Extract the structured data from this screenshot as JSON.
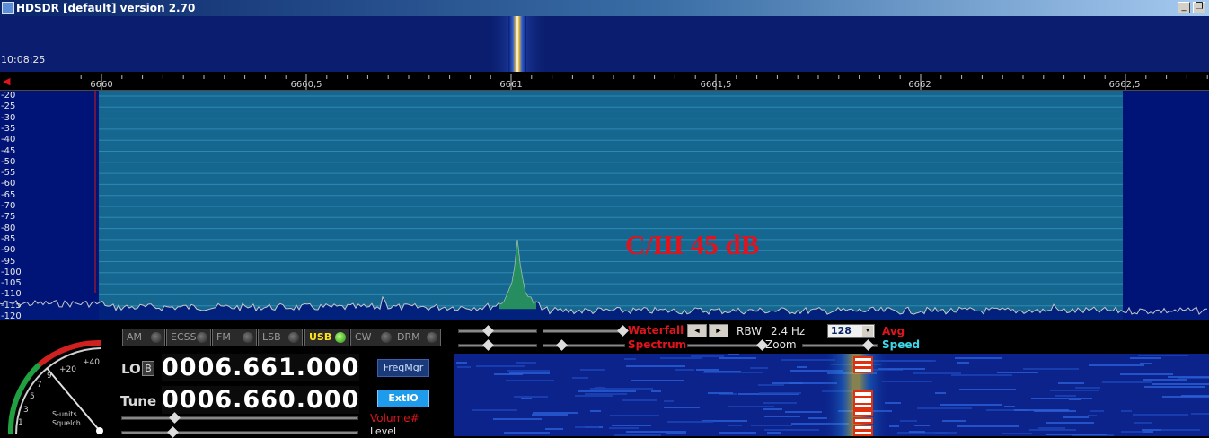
{
  "window": {
    "title": "HDSDR [default]  version 2.70",
    "minimize": "_",
    "restore": "❐"
  },
  "top_waterfall": {
    "time": "10:08:25"
  },
  "ruler": {
    "labels": [
      "6660",
      "6660,5",
      "6661",
      "6661,5",
      "6662",
      "6662,5"
    ]
  },
  "spectrum": {
    "db_labels": [
      "-20",
      "-25",
      "-30",
      "-35",
      "-40",
      "-45",
      "-50",
      "-55",
      "-60",
      "-65",
      "-70",
      "-75",
      "-80",
      "-85",
      "-90",
      "-95",
      "-100",
      "-105",
      "-110",
      "-115",
      "-120"
    ],
    "annotation": "С/Ш 45 dB",
    "peak_level_db": -85,
    "noise_floor_db": -114
  },
  "modes": [
    {
      "label": "AM",
      "active": false
    },
    {
      "label": "ECSS",
      "active": false
    },
    {
      "label": "FM",
      "active": false
    },
    {
      "label": "LSB",
      "active": false
    },
    {
      "label": "USB",
      "active": true
    },
    {
      "label": "CW",
      "active": false
    },
    {
      "label": "DRM",
      "active": false
    }
  ],
  "smeter": {
    "scale": [
      "1",
      "3",
      "5",
      "7",
      "9",
      "+20",
      "+40"
    ],
    "label1": "S-units",
    "label2": "Squelch"
  },
  "lo": {
    "label": "LO",
    "button": "B",
    "value": "0006.661.000"
  },
  "tune": {
    "label": "Tune",
    "value": "0006.660.000"
  },
  "buttons": {
    "freqmgr": "FreqMgr",
    "extio": "ExtIO"
  },
  "audio": {
    "volume": "Volume#",
    "level": "Level"
  },
  "controls": {
    "waterfall": "Waterfall",
    "spectrum": "Spectrum",
    "rbw_label": "RBW",
    "rbw_value": "2.4 Hz",
    "zoom": "Zoom",
    "fft_value": "128",
    "avg": "Avg",
    "speed": "Speed",
    "left_arrow": "◄",
    "right_arrow": "►",
    "dropdown_arrow": "▼"
  },
  "colors": {
    "accent_red": "#e0141e",
    "spectrum_bg": "#001478",
    "active_mode": "#ffe21a"
  }
}
